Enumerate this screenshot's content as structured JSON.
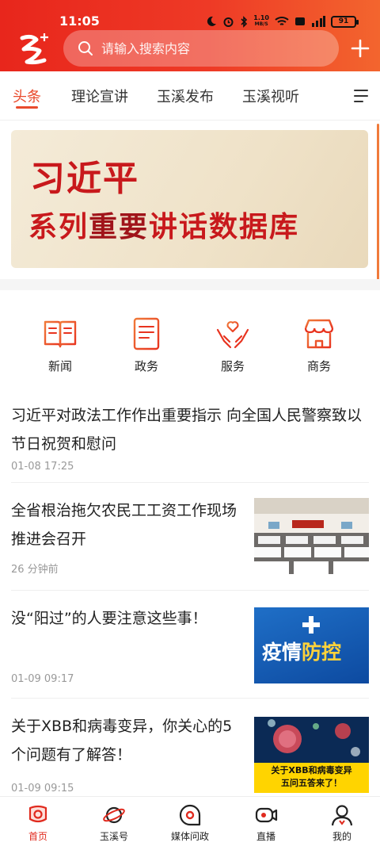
{
  "status": {
    "time": "11:05",
    "speed_value": "1.10",
    "speed_unit": "MB/S",
    "battery": "91"
  },
  "header": {
    "search_placeholder": "请输入搜索内容"
  },
  "tabs": [
    {
      "label": "头条",
      "active": true
    },
    {
      "label": "理论宣讲"
    },
    {
      "label": "玉溪发布"
    },
    {
      "label": "玉溪视听"
    }
  ],
  "banner": {
    "line1": "习近平",
    "line2a": "系列",
    "line2b": "重要",
    "line2c": "讲话数据库"
  },
  "quick": [
    {
      "label": "新闻",
      "icon": "newspaper-icon"
    },
    {
      "label": "政务",
      "icon": "document-icon"
    },
    {
      "label": "服务",
      "icon": "heart-hands-icon"
    },
    {
      "label": "商务",
      "icon": "store-icon"
    }
  ],
  "news": [
    {
      "title": "习近平对政法工作作出重要指示 向全国人民警察致以节日祝贺和慰问",
      "time": "01-08 17:25"
    },
    {
      "title": "全省根治拖欠农民工工资工作现场推进会召开",
      "time": "26 分钟前"
    },
    {
      "title": "没“阳过”的人要注意这些事！",
      "time": "01-09 09:17",
      "image_text_a": "疫情",
      "image_text_b": "防控"
    },
    {
      "title": "关于XBB和病毒变异，你关心的5个问题有了解答！",
      "time": "01-09 09:15",
      "image_text_1": "关于XBB和病毒变异",
      "image_text_2": "五问五答来了！"
    }
  ],
  "bottom_nav": [
    {
      "label": "首页",
      "active": true
    },
    {
      "label": "玉溪号"
    },
    {
      "label": "媒体问政"
    },
    {
      "label": "直播"
    },
    {
      "label": "我的"
    }
  ],
  "colors": {
    "brand_red": "#e8261c",
    "accent": "#e94a2c",
    "time_gray": "#999999"
  }
}
